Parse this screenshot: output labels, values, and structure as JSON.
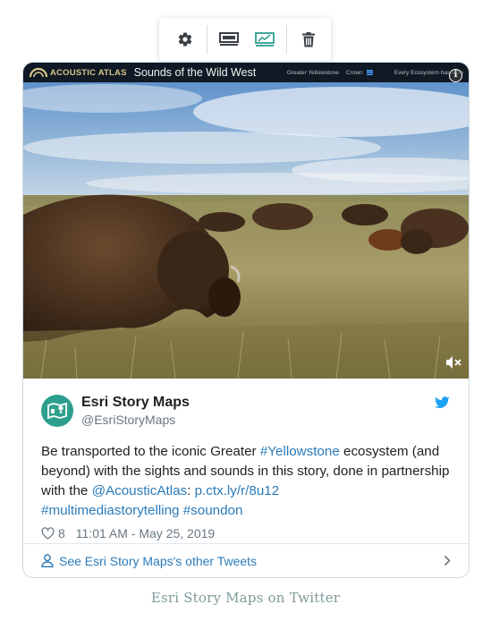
{
  "toolbar": {
    "buttons": [
      {
        "icon": "gear-icon"
      },
      {
        "icon": "media-layout-icon"
      },
      {
        "icon": "chart-layout-icon",
        "color": "#2e9f8e"
      },
      {
        "icon": "trash-icon"
      }
    ]
  },
  "video": {
    "brand": "ACOUSTIC ATLAS",
    "title": "Sounds of the Wild West",
    "nav": [
      "Greater Yellowstone",
      "Crown",
      "Every Ecosystem has a Vo"
    ],
    "info_glyph": "i"
  },
  "tweet": {
    "author_name": "Esri Story Maps",
    "author_handle": "@EsriStoryMaps",
    "text_parts": {
      "p1": "Be transported to the iconic Greater ",
      "tag1": "#Yellowstone",
      "p2": " ecosystem (and beyond) with the sights and sounds in this story, done in partnership with the ",
      "mention": "@AcousticAtlas",
      "p3": ": ",
      "url": "p.ctx.ly/r/8u12",
      "p4": " ",
      "tag2": "#multimediastorytelling",
      "p5": " ",
      "tag3": "#soundon"
    },
    "likes": "8",
    "timestamp": "11:01 AM - May 25, 2019",
    "other_tweets_label": "See Esri Story Maps's other Tweets"
  },
  "caption": "Esri Story Maps on Twitter",
  "colors": {
    "accent_teal": "#2e9f8e",
    "twitter_blue": "#1da1f2",
    "link_blue": "#2b7bb9",
    "caption": "#7f9a9a"
  }
}
